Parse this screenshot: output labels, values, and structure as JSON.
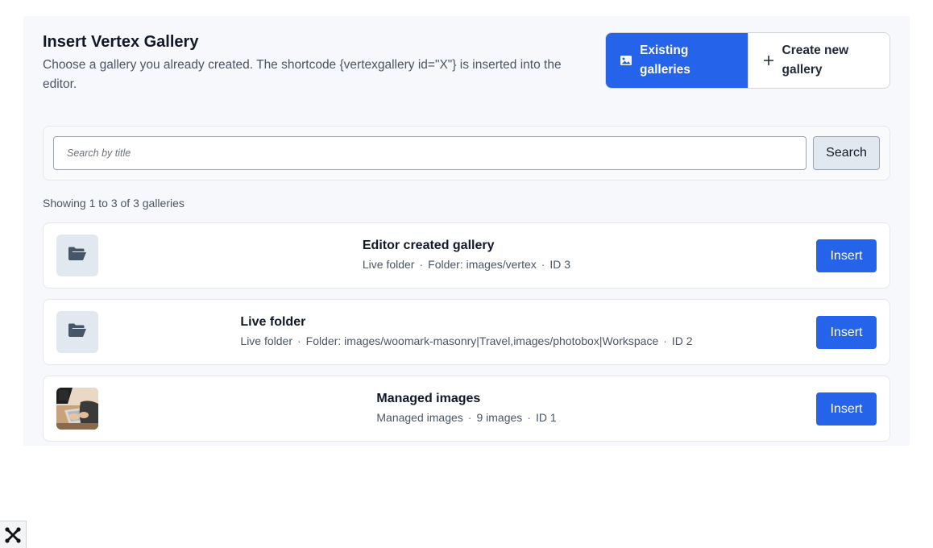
{
  "header": {
    "title": "Insert Vertex Gallery",
    "description": "Choose a gallery you already created. The shortcode {vertexgallery id=\"X\"} is inserted into the editor."
  },
  "mode_switch": {
    "existing_label": "Existing galleries",
    "create_label": "Create new gallery",
    "active": "existing",
    "accent_color": "#2563eb"
  },
  "search": {
    "placeholder": "Search by title",
    "value": "",
    "button_label": "Search"
  },
  "result_count": "Showing 1 to 3 of 3 galleries",
  "galleries": [
    {
      "title": "Editor created gallery",
      "meta": [
        "Live folder",
        "Folder: images/vertex",
        "ID 3"
      ],
      "thumb": "folder-icon",
      "insert_label": "Insert"
    },
    {
      "title": "Live folder",
      "meta": [
        "Live folder",
        "Folder: images/woomark-masonry|Travel,images/photobox|Workspace",
        "ID 2"
      ],
      "thumb": "folder-icon",
      "insert_label": "Insert"
    },
    {
      "title": "Managed images",
      "meta": [
        "Managed images",
        "9 images",
        "ID 1"
      ],
      "thumb": "photo-thumbnail",
      "insert_label": "Insert"
    }
  ],
  "meta_separator": "·",
  "footer_icon": "joomla-logo-icon"
}
